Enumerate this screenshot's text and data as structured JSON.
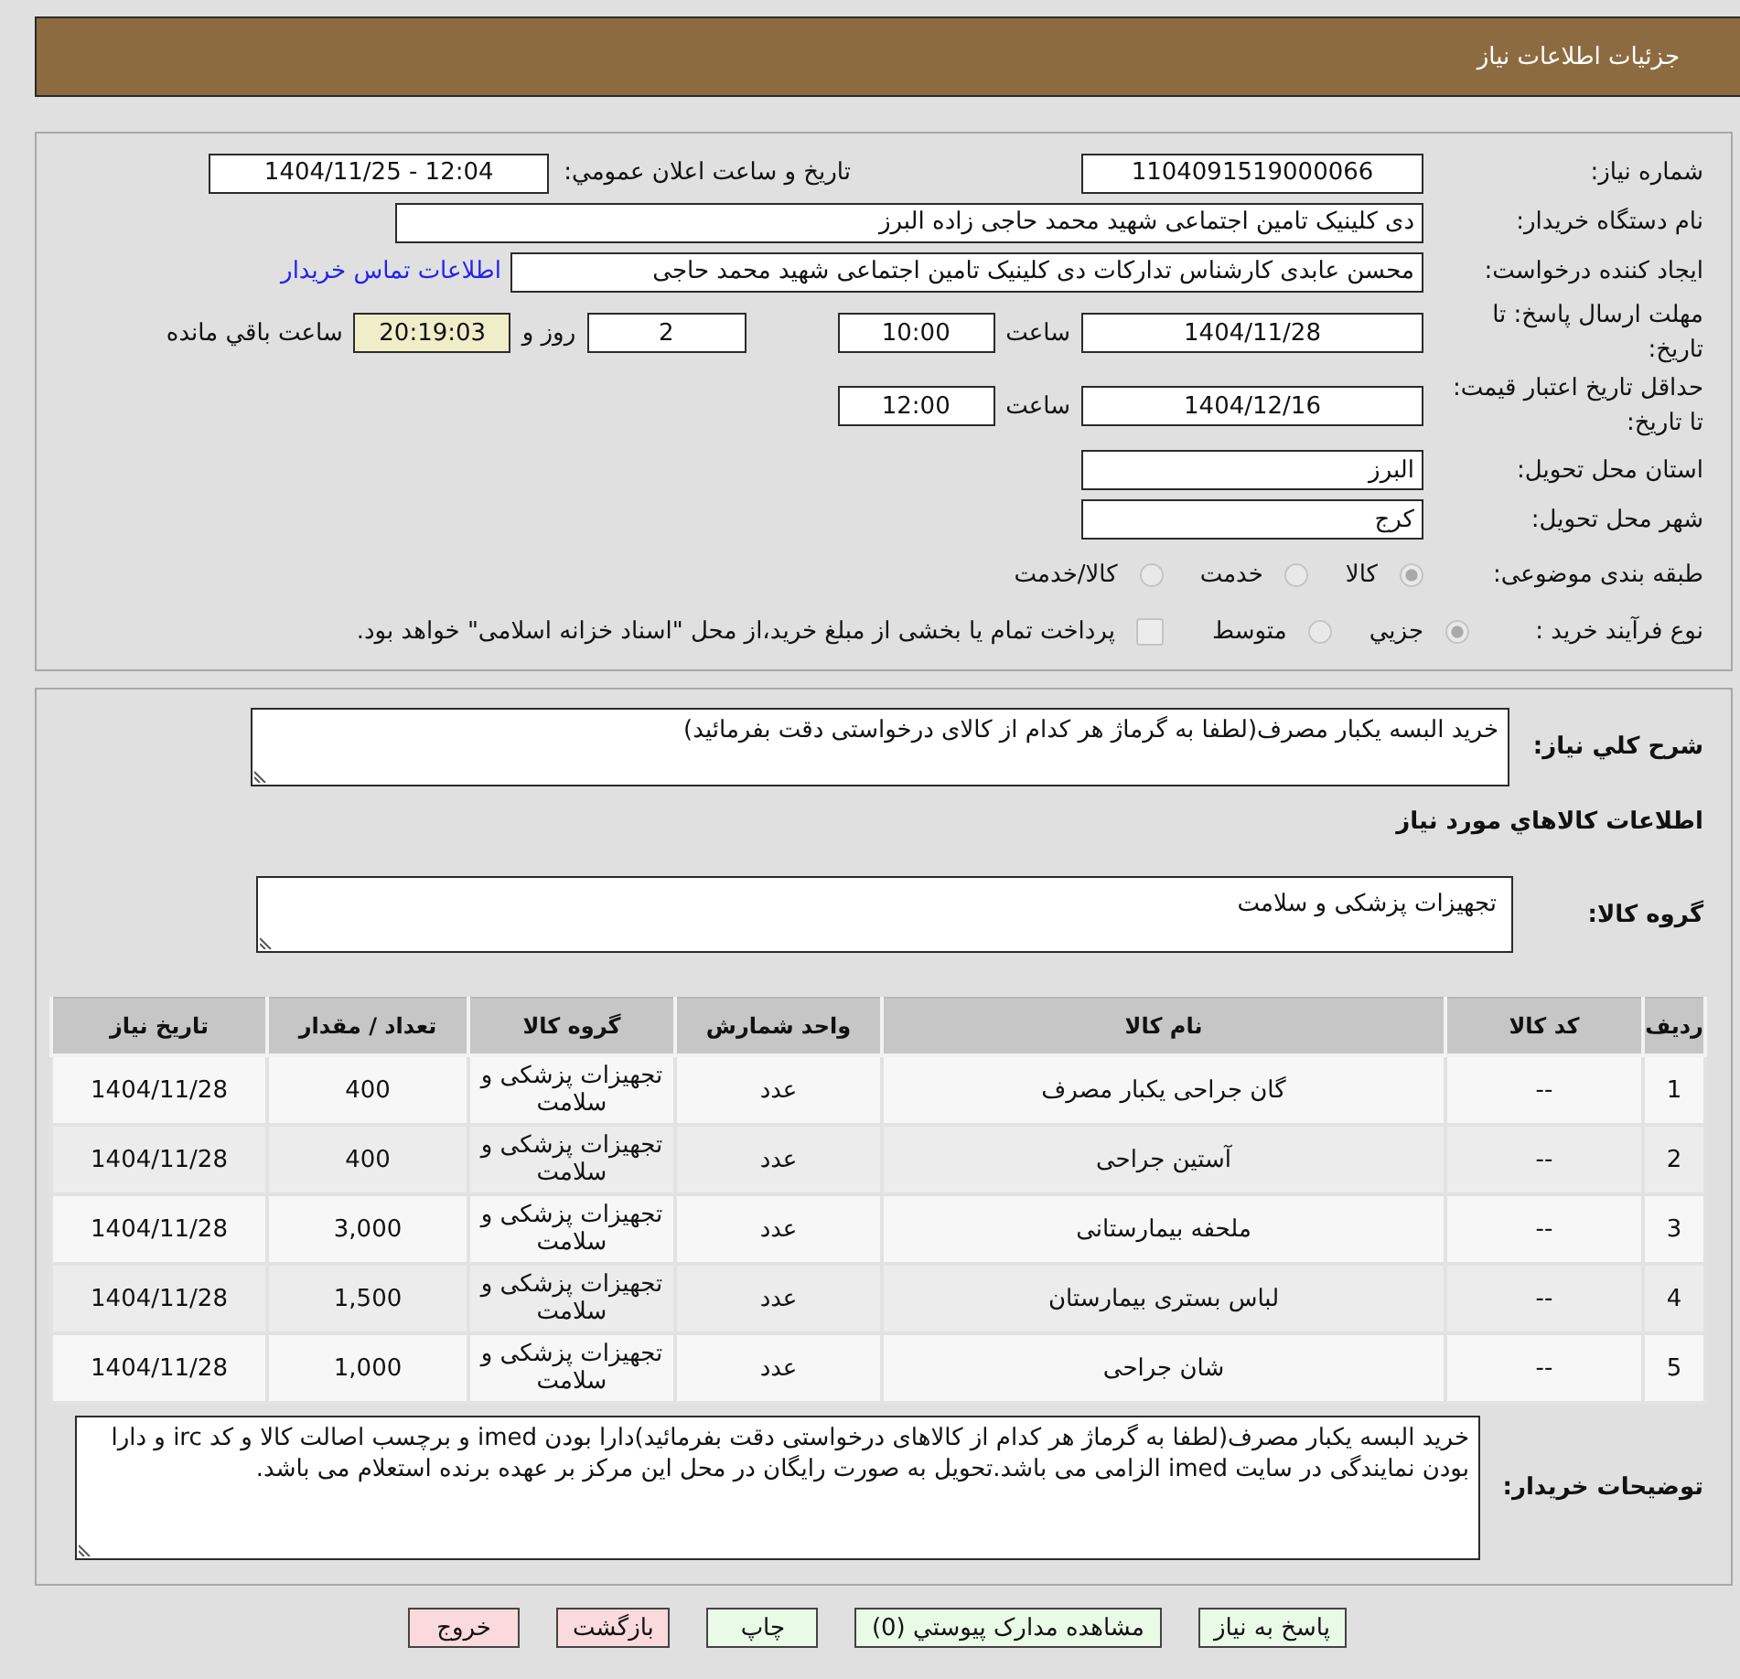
{
  "header": {
    "title": "جزئیات اطلاعات نیاز"
  },
  "details": {
    "need_number": {
      "label": "شماره نیاز:",
      "value": "1104091519000066"
    },
    "announce": {
      "label": "تاریخ و ساعت اعلان عمومي:",
      "value": "1404/11/25 - 12:04"
    },
    "buyer_org": {
      "label": "نام دستگاه خریدار:",
      "value": "دی کلینیک تامین اجتماعی شهید محمد حاجی زاده البرز"
    },
    "creator": {
      "label": "ایجاد کننده درخواست:",
      "value": "محسن عابدی کارشناس تدارکات دی کلینیک تامین اجتماعی شهید محمد حاجی",
      "link": "اطلاعات تماس خریدار"
    },
    "reply_deadline": {
      "label": "مهلت ارسال پاسخ: تا تاریخ:",
      "date": "1404/11/28",
      "time_label": "ساعت",
      "time": "10:00",
      "days": "2",
      "days_label": "روز و",
      "remaining": "20:19:03",
      "remaining_label": "ساعت باقي مانده"
    },
    "price_validity": {
      "label": "حداقل تاریخ اعتبار قیمت: تا تاریخ:",
      "date": "1404/12/16",
      "time_label": "ساعت",
      "time": "12:00"
    },
    "province": {
      "label": "استان محل تحویل:",
      "value": "البرز"
    },
    "city": {
      "label": "شهر محل تحویل:",
      "value": "کرج"
    },
    "category": {
      "label": "طبقه بندی موضوعی:",
      "options": [
        {
          "label": "کالا",
          "selected": true
        },
        {
          "label": "خدمت",
          "selected": false
        },
        {
          "label": "کالا/خدمت",
          "selected": false
        }
      ]
    },
    "process": {
      "label": "نوع فرآیند خرید :",
      "options": [
        {
          "label": "جزيي",
          "selected": true
        },
        {
          "label": "متوسط",
          "selected": false
        }
      ],
      "treasury": {
        "label": "پرداخت تمام یا بخشی از مبلغ خرید،از محل \"اسناد خزانه اسلامی\" خواهد بود.",
        "checked": false
      }
    }
  },
  "summary": {
    "label": "شرح کلي نیاز:",
    "value": "خرید البسه یکبار مصرف(لطفا به گرماژ هر کدام از کالای درخواستی دقت بفرمائید)"
  },
  "goods": {
    "title": "اطلاعات کالاهاي مورد نیاز",
    "group_label": "گروه کالا:",
    "group_value": "تجهیزات پزشکی و سلامت",
    "table": {
      "columns": [
        "ردیف",
        "کد کالا",
        "نام کالا",
        "واحد شمارش",
        "گروه کالا",
        "تعداد / مقدار",
        "تاریخ نیاز"
      ],
      "rows": [
        {
          "cells": [
            "1",
            "--",
            "گان جراحی یکبار مصرف",
            "عدد",
            "تجهیزات پزشکی و سلامت",
            "400",
            "1404/11/28"
          ]
        },
        {
          "cells": [
            "2",
            "--",
            "آستین جراحی",
            "عدد",
            "تجهیزات پزشکی و سلامت",
            "400",
            "1404/11/28"
          ]
        },
        {
          "cells": [
            "3",
            "--",
            "ملحفه بیمارستانی",
            "عدد",
            "تجهیزات پزشکی و سلامت",
            "3,000",
            "1404/11/28"
          ]
        },
        {
          "cells": [
            "4",
            "--",
            "لباس بستری بیمارستان",
            "عدد",
            "تجهیزات پزشکی و سلامت",
            "1,500",
            "1404/11/28"
          ]
        },
        {
          "cells": [
            "5",
            "--",
            "شان جراحی",
            "عدد",
            "تجهیزات پزشکی و سلامت",
            "1,000",
            "1404/11/28"
          ]
        }
      ]
    }
  },
  "buyer_notes": {
    "label": "توضیحات خریدار:",
    "value": "خرید البسه یکبار مصرف(لطفا به گرماژ هر کدام از کالاهای درخواستی دقت بفرمائید)دارا بودن imed و برچسب اصالت کالا و کد irc و دارا بودن نمایندگی در سایت imed الزامی می باشد.تحویل به صورت رایگان در محل این مرکز بر عهده برنده استعلام می باشد."
  },
  "buttons": [
    {
      "label": "پاسخ به نیاز",
      "color": "#e9fbe7"
    },
    {
      "label": "مشاهده مدارک پیوستي (0)",
      "color": "#e9fbe7"
    },
    {
      "label": "چاپ",
      "color": "#e9fbe7"
    },
    {
      "label": "بازگشت",
      "color": "#fbdadd"
    },
    {
      "label": "خروج",
      "color": "#fbdadd"
    }
  ]
}
